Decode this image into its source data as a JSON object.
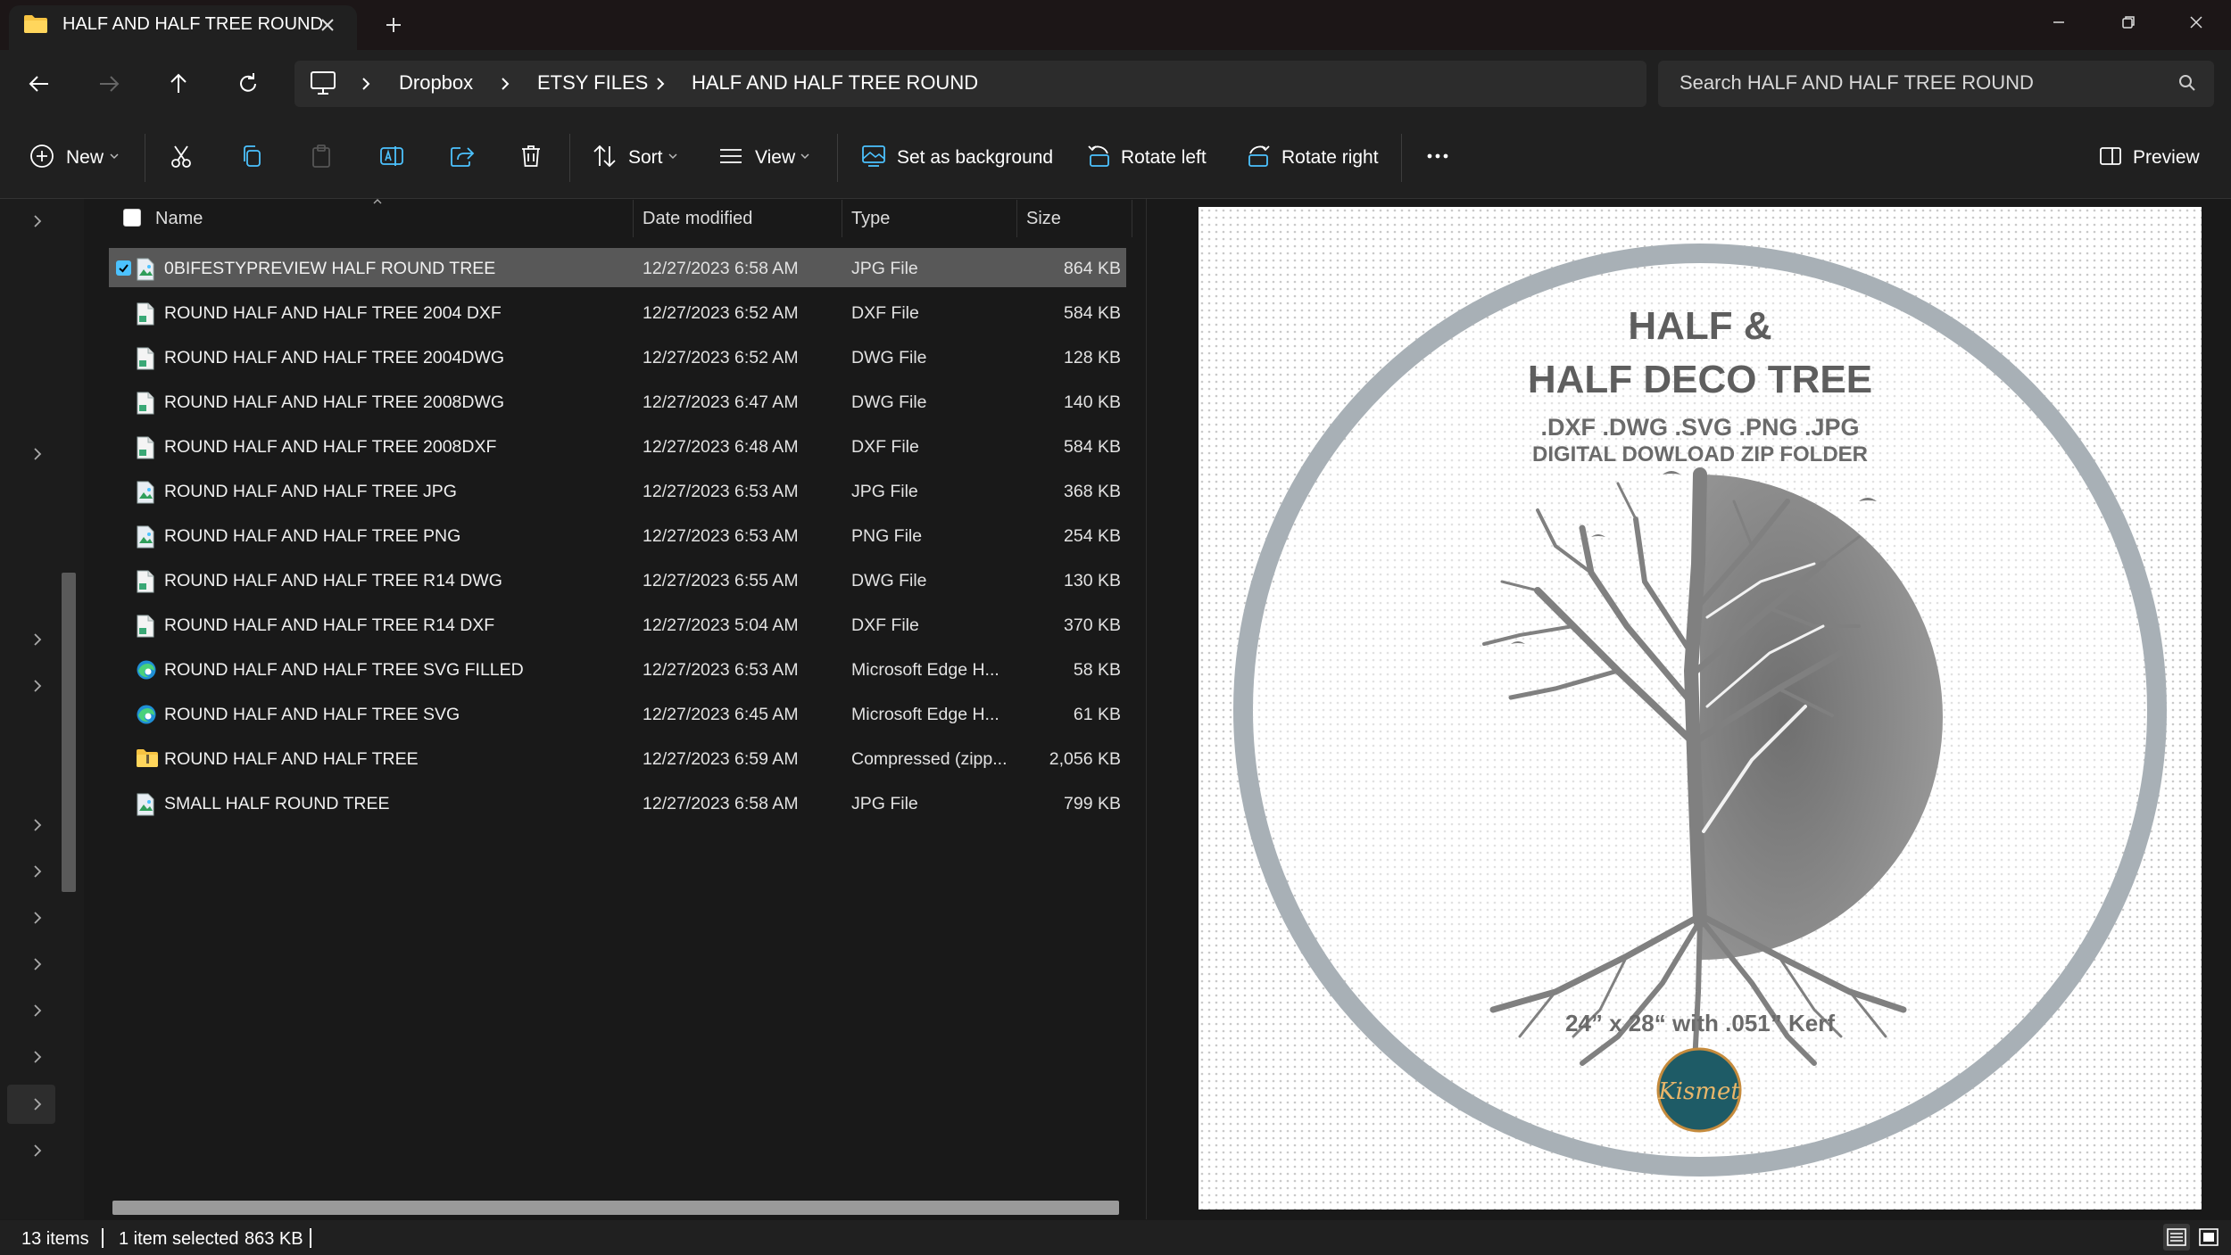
{
  "window": {
    "tab_title": "HALF AND HALF TREE ROUND",
    "controls": [
      "minimize",
      "restore",
      "close"
    ]
  },
  "breadcrumb": [
    "Dropbox",
    "ETSY FILES",
    "HALF AND HALF TREE ROUND"
  ],
  "search": {
    "placeholder": "Search HALF AND HALF TREE ROUND"
  },
  "commands": {
    "new": "New",
    "sort": "Sort",
    "view": "View",
    "set_background": "Set as background",
    "rotate_left": "Rotate left",
    "rotate_right": "Rotate right",
    "preview": "Preview"
  },
  "columns": {
    "name": "Name",
    "date": "Date modified",
    "type": "Type",
    "size": "Size"
  },
  "files": [
    {
      "name": "0BIFESTYPREVIEW HALF ROUND TREE",
      "date": "12/27/2023 6:58 AM",
      "type": "JPG File",
      "size": "864 KB",
      "icon": "image-file-icon",
      "selected": true
    },
    {
      "name": "ROUND HALF AND HALF TREE 2004 DXF",
      "date": "12/27/2023 6:52 AM",
      "type": "DXF File",
      "size": "584 KB",
      "icon": "cad-file-icon"
    },
    {
      "name": "ROUND HALF AND HALF TREE 2004DWG",
      "date": "12/27/2023 6:52 AM",
      "type": "DWG File",
      "size": "128 KB",
      "icon": "cad-file-icon"
    },
    {
      "name": "ROUND HALF AND HALF TREE 2008DWG",
      "date": "12/27/2023 6:47 AM",
      "type": "DWG File",
      "size": "140 KB",
      "icon": "cad-file-icon"
    },
    {
      "name": "ROUND HALF AND HALF TREE 2008DXF",
      "date": "12/27/2023 6:48 AM",
      "type": "DXF File",
      "size": "584 KB",
      "icon": "cad-file-icon"
    },
    {
      "name": "ROUND HALF AND HALF TREE JPG",
      "date": "12/27/2023 6:53 AM",
      "type": "JPG File",
      "size": "368 KB",
      "icon": "image-file-icon"
    },
    {
      "name": "ROUND HALF AND HALF TREE PNG",
      "date": "12/27/2023 6:53 AM",
      "type": "PNG File",
      "size": "254 KB",
      "icon": "image-file-icon"
    },
    {
      "name": "ROUND HALF AND HALF TREE R14 DWG",
      "date": "12/27/2023 6:55 AM",
      "type": "DWG File",
      "size": "130 KB",
      "icon": "cad-file-icon"
    },
    {
      "name": "ROUND HALF AND HALF TREE R14 DXF",
      "date": "12/27/2023 5:04 AM",
      "type": "DXF File",
      "size": "370 KB",
      "icon": "cad-file-icon"
    },
    {
      "name": "ROUND HALF AND HALF TREE SVG FILLED",
      "date": "12/27/2023 6:53 AM",
      "type": "Microsoft Edge H...",
      "size": "58 KB",
      "icon": "edge-icon"
    },
    {
      "name": "ROUND HALF AND HALF TREE SVG",
      "date": "12/27/2023 6:45 AM",
      "type": "Microsoft Edge H...",
      "size": "61 KB",
      "icon": "edge-icon"
    },
    {
      "name": "ROUND HALF AND HALF TREE",
      "date": "12/27/2023 6:59 AM",
      "type": "Compressed (zipp...",
      "size": "2,056 KB",
      "icon": "zip-folder-icon"
    },
    {
      "name": "SMALL HALF ROUND TREE",
      "date": "12/27/2023 6:58 AM",
      "type": "JPG File",
      "size": "799 KB",
      "icon": "image-file-icon"
    }
  ],
  "preview_image": {
    "title_line1": "HALF &",
    "title_line2": "HALF DECO TREE",
    "formats": ".DXF .DWG .SVG .PNG .JPG",
    "subtitle": "DIGITAL DOWLOAD ZIP FOLDER",
    "dimensions": "24” x 28“ with .051” Kerf",
    "logo_text": "Kismet"
  },
  "status": {
    "count": "13 items",
    "selection": "1 item selected",
    "selection_size": "863 KB"
  },
  "colors": {
    "accent": "#4cc2ff",
    "selected_row": "#585858",
    "folder_yellow": "#f6c342",
    "tree_gray": "#7e7e7e",
    "logo_teal": "#1e5b66"
  }
}
